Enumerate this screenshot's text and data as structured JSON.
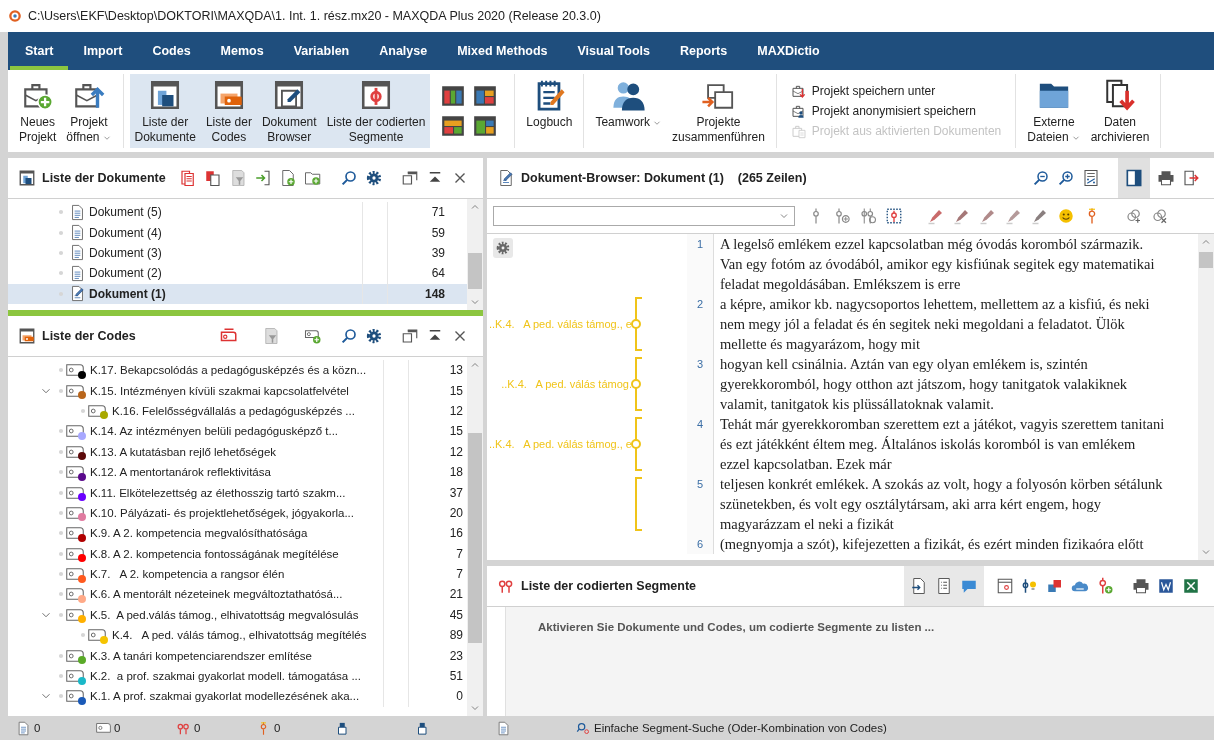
{
  "window": {
    "title": "C:\\Users\\EKF\\Desktop\\DOKTORI\\MAXQDA\\1. Int. 1. rész.mx20 - MAXQDA Plus 2020 (Release 20.3.0)"
  },
  "menu_tabs": [
    {
      "label": "Start",
      "selected": true
    },
    {
      "label": "Import",
      "selected": false
    },
    {
      "label": "Codes",
      "selected": false
    },
    {
      "label": "Memos",
      "selected": false
    },
    {
      "label": "Variablen",
      "selected": false
    },
    {
      "label": "Analyse",
      "selected": false
    },
    {
      "label": "Mixed Methods",
      "selected": false
    },
    {
      "label": "Visual Tools",
      "selected": false
    },
    {
      "label": "Reports",
      "selected": false
    },
    {
      "label": "MAXDictio",
      "selected": false
    }
  ],
  "ribbon": {
    "groups": [
      {
        "items": [
          {
            "kind": "large",
            "lines": [
              "Neues",
              "Projekt"
            ],
            "selected": false,
            "dropdown": false
          },
          {
            "kind": "large",
            "lines": [
              "Projekt",
              "öffnen"
            ],
            "selected": false,
            "dropdown": true
          }
        ]
      },
      {
        "items": [
          {
            "kind": "large",
            "lines": [
              "Liste der",
              "Dokumente"
            ],
            "selected": true,
            "dropdown": false
          },
          {
            "kind": "large",
            "lines": [
              "Liste der",
              "Codes"
            ],
            "selected": true,
            "dropdown": false
          },
          {
            "kind": "large",
            "lines": [
              "Dokument",
              "Browser"
            ],
            "selected": true,
            "dropdown": false
          },
          {
            "kind": "large",
            "lines": [
              "Liste der codierten",
              "Segmente"
            ],
            "selected": true,
            "dropdown": false
          },
          {
            "kind": "layouts"
          }
        ]
      },
      {
        "items": [
          {
            "kind": "large",
            "lines": [
              "Logbuch"
            ],
            "selected": false,
            "dropdown": false
          }
        ]
      },
      {
        "items": [
          {
            "kind": "large",
            "lines": [
              "Teamwork"
            ],
            "selected": false,
            "dropdown": true
          },
          {
            "kind": "large",
            "lines": [
              "Projekte",
              "zusammenführen"
            ],
            "selected": false,
            "dropdown": false
          }
        ]
      },
      {
        "items": [
          {
            "kind": "small-list",
            "entries": [
              {
                "label": "Projekt speichern unter",
                "disabled": false
              },
              {
                "label": "Projekt anonymisiert speichern",
                "disabled": false
              },
              {
                "label": "Projekt aus aktivierten Dokumenten",
                "disabled": true
              }
            ]
          }
        ]
      },
      {
        "items": [
          {
            "kind": "large",
            "lines": [
              "Externe",
              "Dateien"
            ],
            "selected": false,
            "dropdown": true
          },
          {
            "kind": "large",
            "lines": [
              "Daten",
              "archivieren"
            ],
            "selected": false,
            "dropdown": false
          }
        ]
      }
    ]
  },
  "documents_panel": {
    "title": "Liste der Dokumente",
    "rows": [
      {
        "name": "Dokument (5)",
        "count": "71",
        "selected": false
      },
      {
        "name": "Dokument (4)",
        "count": "59",
        "selected": false
      },
      {
        "name": "Dokument (3)",
        "count": "39",
        "selected": false
      },
      {
        "name": "Dokument (2)",
        "count": "64",
        "selected": false
      },
      {
        "name": "Dokument (1)",
        "count": "148",
        "selected": true
      }
    ]
  },
  "codes_panel": {
    "title": "Liste der Codes",
    "codes": [
      {
        "name": "K.17. Bekapcsolódás a pedagógusképzés és a közn...",
        "count": "13",
        "color": "#000000",
        "expanded": false
      },
      {
        "name": "K.15. Intézményen kívüli szakmai kapcsolatfelvétel",
        "count": "15",
        "color": "#b8651b",
        "expanded": true,
        "children": [
          {
            "name": "K.16. Felelősségvállalás a pedagógusképzés ...",
            "count": "12",
            "color": "#a8a800",
            "expanded": false
          }
        ]
      },
      {
        "name": "K.14. Az intézményen belüli pedagógusképző t...",
        "count": "15",
        "color": "#a8a8ff",
        "expanded": false
      },
      {
        "name": "K.13. A kutatásban rejlő lehetőségek",
        "count": "12",
        "color": "#5c0a0a",
        "expanded": false
      },
      {
        "name": "K.12. A mentortanárok reflektivitása",
        "count": "18",
        "color": "#5a0a8c",
        "expanded": false
      },
      {
        "name": "K.11. Elkötelezettség az élethosszig tartó szakm...",
        "count": "37",
        "color": "#6a00ff",
        "expanded": false
      },
      {
        "name": "K.10. Pályázati- és projektlehetőségek, jógyakorla...",
        "count": "20",
        "color": "#e07ba0",
        "expanded": false
      },
      {
        "name": "K.9. A 2. kompetencia megvalósíthatósága",
        "count": "16",
        "color": "#b00000",
        "expanded": false
      },
      {
        "name": "K.8. A 2. kompetencia fontosságának megítélése",
        "count": "7",
        "color": "#ff0000",
        "expanded": false
      },
      {
        "name": "K.7.   A 2. kompetencia a rangsor élén",
        "count": "7",
        "color": "#ff5a1f",
        "expanded": false
      },
      {
        "name": "K.6. A mentorált nézeteinek megváltoztathatósá...",
        "count": "21",
        "color": "#ffaa88",
        "expanded": false
      },
      {
        "name": "K.5.  A ped.válás támog., elhivatottság megvalósulás",
        "count": "45",
        "color": "#ffb000",
        "expanded": true,
        "children": [
          {
            "name": "K.4.   A ped. válás támog., elhivatottság megítélés",
            "count": "89",
            "color": "#f5c400",
            "expanded": false
          }
        ]
      },
      {
        "name": "K.3. A tanári kompetenciarendszer említése",
        "count": "23",
        "color": "#5aaa28",
        "expanded": false
      },
      {
        "name": "K.2.  a prof. szakmai gyakorlat modell. támogatása ...",
        "count": "51",
        "color": "#1ab8c8",
        "expanded": false
      },
      {
        "name": "K.1. A prof. szakmai gyakorlat modellezésének aka...",
        "count": "0",
        "color": "#1a5ab8",
        "expanded": true
      }
    ]
  },
  "document_browser": {
    "title": "Dokument-Browser: Dokument (1)",
    "line_count": "(265 Zeilen)",
    "paragraphs": [
      {
        "number": "1",
        "lines": [
          "A legelső emlékem ezzel kapcsolatban még óvodás koromból származik.",
          "Van egy fotóm az óvodából, amikor egy kisfiúnak segitek egy matematikai",
          "feladat megoldásában. Emlékszem is erre"
        ]
      },
      {
        "number": "2",
        "lines": [
          "a képre, amikor kb. nagycsoportos lehettem, mellettem az a kisfiú, és neki",
          "nem megy jól a feladat és én segitek neki megoldani a feladatot. Ülök",
          "mellette és magyarázom, hogy mit"
        ],
        "coding": {
          "label": "..K.4.   A ped. válás támog., e",
          "color": "#f0c419"
        }
      },
      {
        "number": "3",
        "lines": [
          "hogyan kell csinálnia. Aztán van egy olyan emlékem is, szintén",
          "gyerekkoromból, hogy otthon azt játszom, hogy tanitgatok valakiknek",
          "valamit, tanitgatok kis plüssállatoknak valamit."
        ],
        "coding": {
          "label": "..K.4.   A ped. válás támog.",
          "color": "#f0c419"
        }
      },
      {
        "number": "4",
        "lines": [
          "Tehát már gyerekkoromban szerettem ezt a játékot, vagyis szerettem tanitani",
          "és ezt játékként éltem meg. Általános iskolás koromból is van emlékem",
          "ezzel kapcsolatban. Ezek már"
        ],
        "coding": {
          "label": "..K.4.   A ped. válás támog., e",
          "color": "#f0c419"
        }
      },
      {
        "number": "5",
        "lines": [
          "teljesen konkrét emlékek. A szokás az volt, hogy a folyosón körben sétálunk",
          "szünetekben, és volt egy osztálytársam, aki arra kért engem, hogy",
          "magyarázzam el neki a fizikát"
        ],
        "coding": {
          "color": "#f0c419"
        }
      },
      {
        "number": "6",
        "lines": [
          "(megnyomja a szót), kifejezetten a fizikát, és ezért minden fizikaóra előtt"
        ]
      }
    ]
  },
  "segments_panel": {
    "title": "Liste der codierten Segmente",
    "message": "Aktivieren Sie Dokumente und Codes, um codierte Segmente zu listen ..."
  },
  "status_bar": {
    "counters": [
      "0",
      "0",
      "0",
      "0"
    ],
    "search_mode": "Einfache Segment-Suche (Oder-Kombination von Codes)"
  }
}
